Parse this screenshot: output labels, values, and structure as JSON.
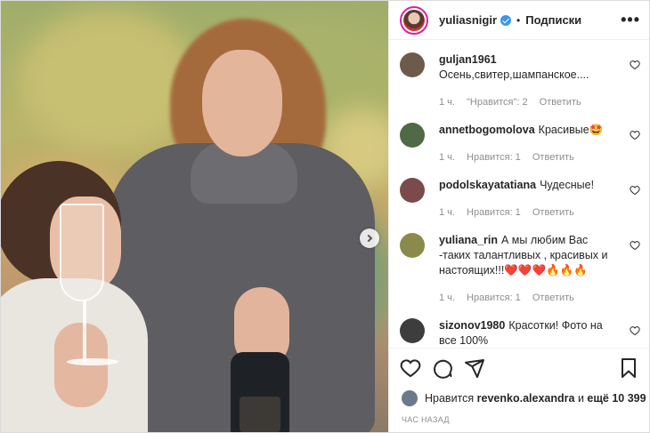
{
  "post": {
    "author": "yuliasnigir",
    "separator": "•",
    "follow_label": "Подписки",
    "more_label": "•••"
  },
  "comments": [
    {
      "user": "guljan1961",
      "text": "Осень,свитер,шампанское....",
      "time": "1 ч.",
      "likes": "\"Нравится\": 2",
      "reply": "Ответить",
      "avatar_color": "#6e5a4a"
    },
    {
      "user": "annetbogomolova",
      "text": "Красивые🤩",
      "time": "1 ч.",
      "likes": "Нравится: 1",
      "reply": "Ответить",
      "avatar_color": "#4f6a44"
    },
    {
      "user": "podolskayatatiana",
      "text": "Чудесные!",
      "time": "1 ч.",
      "likes": "Нравится: 1",
      "reply": "Ответить",
      "avatar_color": "#7a4b4b"
    },
    {
      "user": "yuliana_rin",
      "text": "А мы любим Вас -таких талантливых , красивых и настоящих!!!❤️❤️❤️🔥🔥🔥",
      "time": "1 ч.",
      "likes": "Нравится: 1",
      "reply": "Ответить",
      "avatar_color": "#8a8a4a"
    },
    {
      "user": "sizonov1980",
      "text": "Красотки! Фото на все 100%",
      "time": "",
      "likes": "",
      "reply": "",
      "avatar_color": "#3d3d3d"
    }
  ],
  "likes": {
    "prefix": "Нравится",
    "user": "revenko.alexandra",
    "middle": "и",
    "others": "ещё 10 399"
  },
  "timestamp": "ЧАС НАЗАД",
  "colors": {
    "accent": "#3897f0",
    "muted": "#8e8e8e",
    "border": "#dbdbdb"
  }
}
